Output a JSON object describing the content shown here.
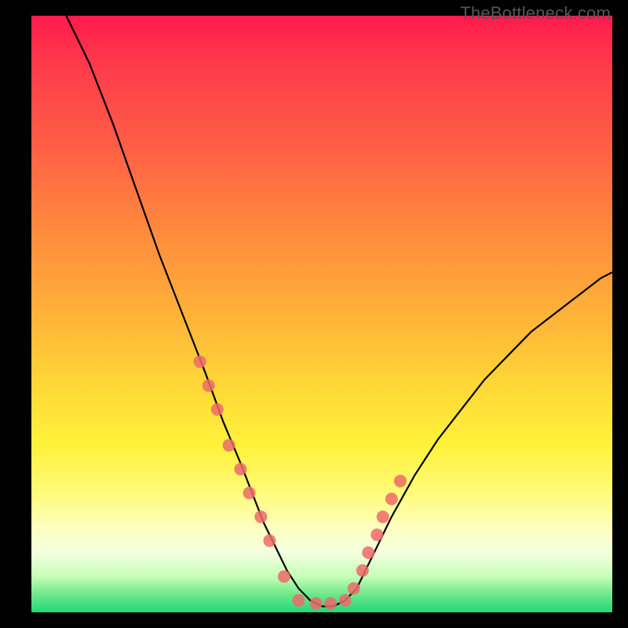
{
  "attribution": "TheBottleneck.com",
  "chart_data": {
    "type": "line",
    "title": "",
    "xlabel": "",
    "ylabel": "",
    "xlim": [
      0,
      100
    ],
    "ylim": [
      0,
      100
    ],
    "grid": false,
    "legend": false,
    "background_gradient_meaning": "bottleneck-severity-heatmap",
    "series": [
      {
        "name": "bottleneck-curve",
        "color": "#000000",
        "x": [
          6,
          10,
          14,
          18,
          22,
          26,
          30,
          33,
          36,
          38,
          40,
          42,
          44,
          46,
          48,
          50,
          52,
          54,
          56,
          58,
          62,
          66,
          70,
          74,
          78,
          82,
          86,
          90,
          94,
          98,
          100
        ],
        "y": [
          100,
          92,
          82,
          71,
          60,
          50,
          40,
          32,
          25,
          20,
          15,
          11,
          7,
          4,
          2,
          1,
          1,
          2,
          4,
          8,
          16,
          23,
          29,
          34,
          39,
          43,
          47,
          50,
          53,
          56,
          57
        ]
      }
    ],
    "markers": {
      "name": "sample-points",
      "color": "#ed6a6a",
      "radius_px": 8,
      "x": [
        29,
        30.5,
        32,
        34,
        36,
        37.5,
        39.5,
        41,
        43.5,
        46,
        49,
        51.5,
        54,
        55.5,
        57,
        58,
        59.5,
        60.5,
        62,
        63.5
      ],
      "y": [
        42,
        38,
        34,
        28,
        24,
        20,
        16,
        12,
        6,
        2,
        1.5,
        1.5,
        2,
        4,
        7,
        10,
        13,
        16,
        19,
        22
      ]
    }
  }
}
